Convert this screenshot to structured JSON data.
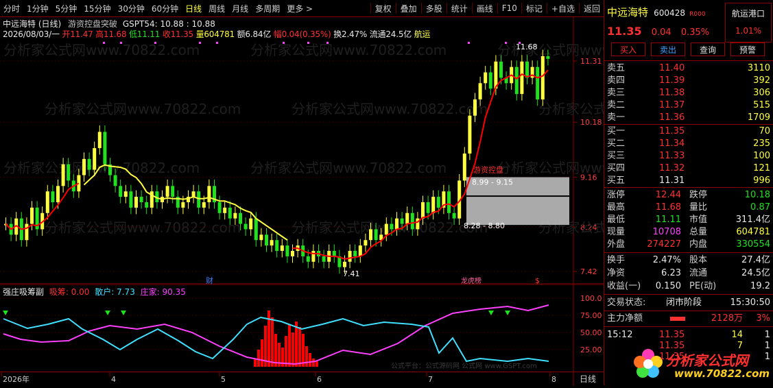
{
  "toolbar": {
    "periods": [
      "分时",
      "1分钟",
      "5分钟",
      "15分钟",
      "30分钟",
      "60分钟",
      "日线",
      "周线",
      "月线",
      "多周期",
      "更多 >"
    ],
    "selected": "日线",
    "tools": [
      "复权",
      "叠加",
      "多股",
      "统计",
      "画线",
      "F10",
      "标记",
      "+自选",
      "返回"
    ]
  },
  "chart_header": {
    "title": "中远海特 (日线)",
    "indicator_name": "游资控盘突破",
    "indicator_values": "GSPT54: 10.88 : 10.88",
    "date": "2026/08/03/一",
    "open": "开11.47",
    "high": "高11.68",
    "low": "低11.11",
    "close": "收11.35",
    "volume": "量604781",
    "amount": "额6.84亿",
    "change": "幅0.04(0.35%)",
    "turnover": "换2.47%",
    "float": "流通24.5亿",
    "sector": "航运"
  },
  "annotations": {
    "max_label": "11.68",
    "min_label": "7.41",
    "zone_upper": "8.99 - 9.15",
    "zone_lower": "8.28 - 8.80",
    "zone_text": "游资控盘",
    "fin_marker": "财",
    "longhu_marker": "龙虎榜",
    "dollar_marker": "$",
    "watermark": "分析家公式网www.70822.com"
  },
  "price_axis": [
    "11.31",
    "10.18",
    "9.16",
    "8.24",
    "7.42"
  ],
  "sub_header": {
    "name": "强庄吸筹副",
    "xichou": "吸筹: 0.00",
    "sanhu": "散户: 7.73",
    "zhuangjia": "庄家: 90.35",
    "watermark": "公式平台：公式源码网 公式网 www.GSPT.com"
  },
  "sub_axis": [
    "100.0",
    "75.00",
    "50.00",
    "25.00"
  ],
  "bottom_axis": {
    "labels": [
      "2026年",
      "4",
      "5",
      "6",
      "7",
      "8"
    ],
    "period": "日线"
  },
  "stock": {
    "name": "中远海特",
    "code": "600428",
    "badge": "R000",
    "sector": "航运港口",
    "sector_pct": "1.01%",
    "price": "11.35",
    "change": "0.04",
    "pct": "0.35%"
  },
  "trade_buttons": [
    "买入",
    "卖出",
    "查询",
    "预警"
  ],
  "order_book": {
    "sells": [
      {
        "label": "卖五",
        "price": "11.40",
        "vol": "3110"
      },
      {
        "label": "卖四",
        "price": "11.39",
        "vol": "392"
      },
      {
        "label": "卖三",
        "price": "11.38",
        "vol": "306"
      },
      {
        "label": "卖二",
        "price": "11.37",
        "vol": "515"
      },
      {
        "label": "卖一",
        "price": "11.36",
        "vol": "1709"
      }
    ],
    "buys": [
      {
        "label": "买一",
        "price": "11.35",
        "vol": "70"
      },
      {
        "label": "买二",
        "price": "11.34",
        "vol": "235"
      },
      {
        "label": "买三",
        "price": "11.33",
        "vol": "100"
      },
      {
        "label": "买四",
        "price": "11.32",
        "vol": "121"
      },
      {
        "label": "买五",
        "price": "11.31",
        "vol": "996"
      }
    ]
  },
  "stats": {
    "zhangting": {
      "label": "涨停",
      "value": "12.44"
    },
    "dieting": {
      "label": "跌停",
      "value": "10.18"
    },
    "zuigao": {
      "label": "最高",
      "value": "11.68"
    },
    "liangbi": {
      "label": "量比",
      "value": "0.87"
    },
    "zuidi": {
      "label": "最低",
      "value": "11.11"
    },
    "shizhi": {
      "label": "市值",
      "value": "311.4亿"
    },
    "xianliang": {
      "label": "现量",
      "value": "10708"
    },
    "zongliang": {
      "label": "总量",
      "value": "604781"
    },
    "waipan": {
      "label": "外盘",
      "value": "274227"
    },
    "neipan": {
      "label": "内盘",
      "value": "330554"
    },
    "huanshou": {
      "label": "换手",
      "value": "2.47%"
    },
    "guben": {
      "label": "股本",
      "value": "27.4亿"
    },
    "jingzi": {
      "label": "净资",
      "value": "6.23"
    },
    "liutong": {
      "label": "流通",
      "value": "24.5亿"
    },
    "shouyi": {
      "label": "收益(一)",
      "value": "0.150"
    },
    "pe": {
      "label": "PE(动)",
      "value": "19.2"
    }
  },
  "status": {
    "label": "交易状态:",
    "value": "闭市阶段",
    "time": "15:30:50"
  },
  "main_force": {
    "label": "主力净额",
    "value": "2128万",
    "pct": "3%"
  },
  "ticks": [
    {
      "time": "15:12",
      "price": "11.35",
      "vol": "14",
      "flag": "1"
    },
    {
      "time": "",
      "price": "11.35",
      "vol": "7",
      "flag": "1"
    },
    {
      "time": "",
      "price": "11.35",
      "vol": "",
      "flag": "1"
    }
  ],
  "logo": {
    "text": "分析家公式网",
    "url": "www.70822.com"
  },
  "colors": {
    "up": "#ffff40",
    "down": "#20e020",
    "ma": "#ff0000",
    "ma2": "#ffff40",
    "sanhu": "#40e0ff",
    "zhuangjia": "#ff40ff",
    "xichou": "#ff0000",
    "border": "#8b0000"
  }
}
